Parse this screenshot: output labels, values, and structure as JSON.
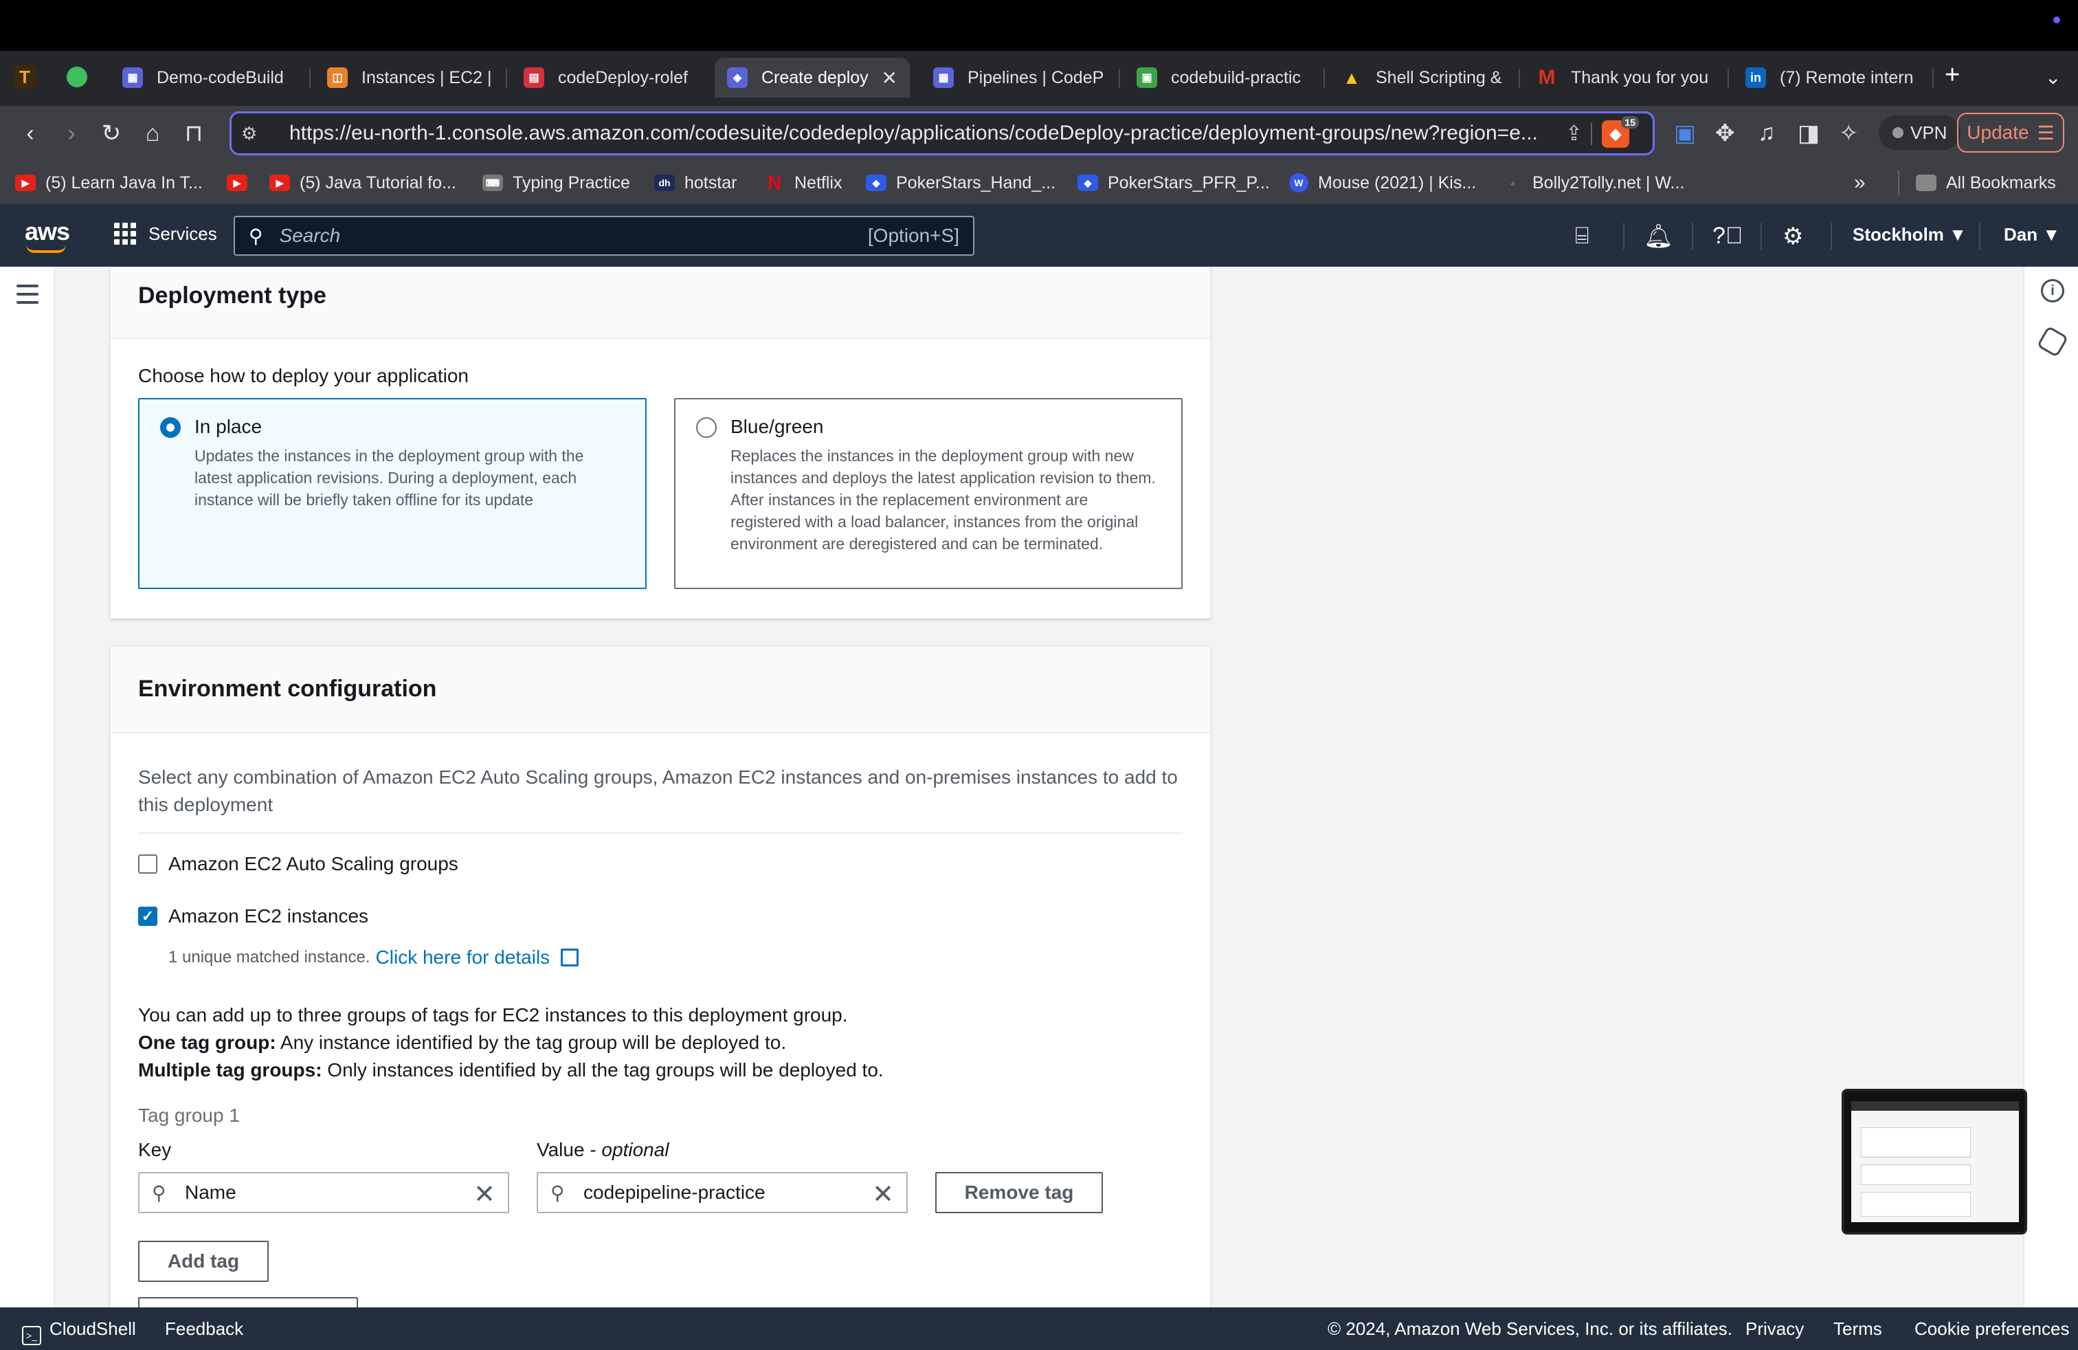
{
  "browser": {
    "pinned": [
      {
        "letter": "T",
        "color": "#f5a623"
      },
      {
        "letter": "",
        "color": "#3fbf5f"
      }
    ],
    "tabs": [
      {
        "title": "Demo-codeBuild",
        "color": "#5a63d8"
      },
      {
        "title": "Instances | EC2 |",
        "color": "#e8822a"
      },
      {
        "title": "codeDeploy-rolef",
        "color": "#d0343b"
      },
      {
        "title": "Create deploy",
        "color": "#5a63d8",
        "active": true
      },
      {
        "title": "Pipelines | CodeP",
        "color": "#5a63d8"
      },
      {
        "title": "codebuild-practic",
        "color": "#3fa34d"
      },
      {
        "title": "Shell Scripting &",
        "color": "#1e9e50"
      },
      {
        "title": "Thank you for you",
        "color": "#d93025"
      },
      {
        "title": "(7) Remote intern",
        "color": "#0a66c2"
      }
    ],
    "new_tab": "+",
    "tab_menu": "⌄",
    "url": "https://eu-north-1.console.aws.amazon.com/codesuite/codedeploy/applications/codeDeploy-practice/deployment-groups/new?region=e...",
    "shield_count": "15",
    "vpn_label": "VPN",
    "update_label": "Update",
    "bookmarks": [
      {
        "label": "(5) Learn Java In T...",
        "color": "#e62117"
      },
      {
        "label": "",
        "color": "#e62117"
      },
      {
        "label": "(5) Java Tutorial fo...",
        "color": "#e62117"
      },
      {
        "label": "Typing Practice",
        "color": "#777777"
      },
      {
        "label": "hotstar",
        "color": "#1f2a58"
      },
      {
        "label": "Netflix",
        "color": "#e50914"
      },
      {
        "label": "PokerStars_Hand_...",
        "color": "#2d5be3"
      },
      {
        "label": "PokerStars_PFR_P...",
        "color": "#2d5be3"
      },
      {
        "label": "Mouse (2021) | Kis...",
        "color": "#3858e9"
      },
      {
        "label": "Bolly2Tolly.net | W...",
        "color": "#8a6b3a"
      }
    ],
    "bookmarks_more": "»",
    "all_bookmarks": "All Bookmarks"
  },
  "aws_header": {
    "logo": "aws",
    "services": "Services",
    "search_placeholder": "Search",
    "search_shortcut": "[Option+S]",
    "region": "Stockholm ▼",
    "user": "Dan ▼"
  },
  "deployment_type": {
    "title": "Deployment type",
    "prompt": "Choose how to deploy your application",
    "options": [
      {
        "title": "In place",
        "desc": "Updates the instances in the deployment group with the latest application revisions. During a deployment, each instance will be briefly taken offline for its update",
        "selected": true
      },
      {
        "title": "Blue/green",
        "desc": "Replaces the instances in the deployment group with new instances and deploys the latest application revision to them. After instances in the replacement environment are registered with a load balancer, instances from the original environment are deregistered and can be terminated.",
        "selected": false
      }
    ]
  },
  "environment": {
    "title": "Environment configuration",
    "desc": "Select any combination of Amazon EC2 Auto Scaling groups, Amazon EC2 instances and on-premises instances to add to this deployment",
    "asg_label": "Amazon EC2 Auto Scaling groups",
    "asg_checked": false,
    "ec2_label": "Amazon EC2 instances",
    "ec2_checked": true,
    "matched_text": "1 unique matched instance.",
    "details_link": "Click here for details",
    "tags_intro": "You can add up to three groups of tags for EC2 instances to this deployment group.",
    "one_tag_bold": "One tag group:",
    "one_tag_text": " Any instance identified by the tag group will be deployed to.",
    "multi_tag_bold": "Multiple tag groups:",
    "multi_tag_text": " Only instances identified by all the tag groups will be deployed to.",
    "tag_group_label": "Tag group 1",
    "key_label": "Key",
    "value_label": "Value - ",
    "value_optional": "optional",
    "key_value": "Name",
    "value_value": "codepipeline-practice",
    "remove_tag": "Remove tag",
    "add_tag": "Add tag"
  },
  "footer": {
    "cloudshell": "CloudShell",
    "feedback": "Feedback",
    "copyright": "© 2024, Amazon Web Services, Inc. or its affiliates.",
    "privacy": "Privacy",
    "terms": "Terms",
    "cookies": "Cookie preferences"
  }
}
